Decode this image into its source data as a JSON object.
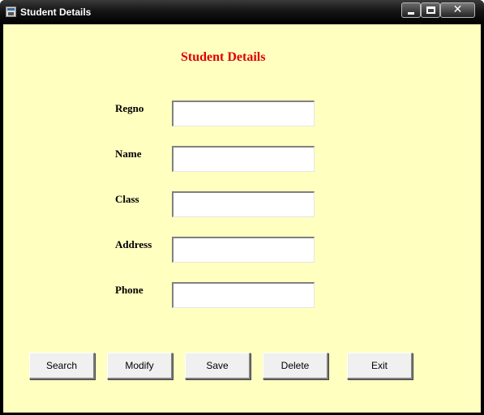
{
  "window": {
    "title": "Student Details",
    "controls": {
      "minimize_icon": "minimize-icon",
      "maximize_icon": "maximize-icon",
      "close_glyph": "✕"
    }
  },
  "form": {
    "heading": "Student Details",
    "heading_color": "#e00000",
    "background_color": "#ffffc0",
    "fields": [
      {
        "label": "Regno",
        "value": ""
      },
      {
        "label": "Name",
        "value": ""
      },
      {
        "label": "Class",
        "value": ""
      },
      {
        "label": "Address",
        "value": ""
      },
      {
        "label": "Phone",
        "value": ""
      }
    ]
  },
  "buttons": {
    "search": "Search",
    "modify": "Modify",
    "save": "Save",
    "delete": "Delete",
    "exit": "Exit"
  }
}
